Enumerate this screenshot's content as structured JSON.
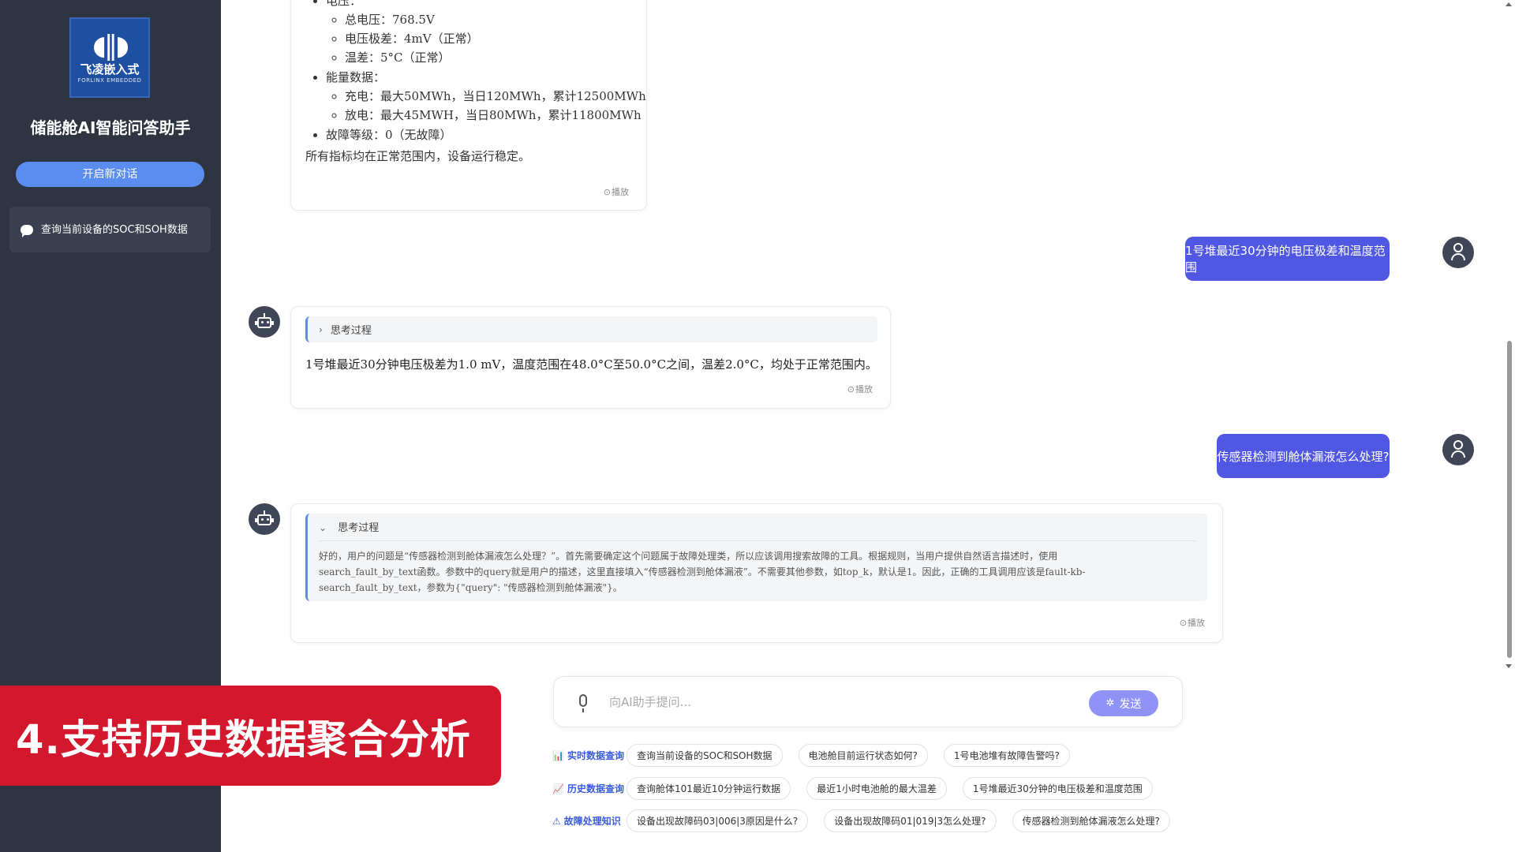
{
  "sidebar": {
    "logo": {
      "brand": "飞凌嵌入式",
      "sub": "FORLINX EMBEDDED"
    },
    "app_title": "储能舱AI智能问答助手",
    "new_chat_label": "开启新对话",
    "history": [
      {
        "label": "查询当前设备的SOC和SOH数据"
      }
    ]
  },
  "conversation": {
    "msg1": {
      "partial_heading": "电压：",
      "voltage_items": [
        "总电压：768.5V",
        "电压极差：4mV（正常）",
        "温差：5°C（正常）"
      ],
      "energy_heading": "能量数据：",
      "energy_items": [
        "充电：最大50MWh，当日120MWh，累计12500MWh",
        "放电：最大45MWH，当日80MWh，累计11800MWh"
      ],
      "fault_level": "故障等级：0（无故障）",
      "conclusion": "所有指标均在正常范围内，设备运行稳定。",
      "play_label": "播放"
    },
    "user1": "1号堆最近30分钟的电压极差和温度范围",
    "msg2": {
      "think_label": "思考过程",
      "answer": "1号堆最近30分钟电压极差为1.0 mV，温度范围在48.0°C至50.0°C之间，温差2.0°C，均处于正常范围内。",
      "play_label": "播放"
    },
    "user2": "传感器检测到舱体漏液怎么处理?",
    "msg3": {
      "think_label": "思考过程",
      "think_body": "好的，用户的问题是“传感器检测到舱体漏液怎么处理？”。首先需要确定这个问题属于故障处理类，所以应该调用搜索故障的工具。根据规则，当用户提供自然语言描述时，使用search_fault_by_text函数。参数中的query就是用户的描述，这里直接填入“传感器检测到舱体漏液”。不需要其他参数，如top_k，默认是1。因此，正确的工具调用应该是fault-kb-search_fault_by_text，参数为{\"query\": \"传感器检测到舱体漏液\"}。",
      "play_label": "播放"
    }
  },
  "input": {
    "placeholder": "向AI助手提问...",
    "send_label": "发送"
  },
  "quick": [
    {
      "label": "实时数据查询",
      "icon": "bar-chart-icon",
      "chips": [
        "查询当前设备的SOC和SOH数据",
        "电池舱目前运行状态如何?",
        "1号电池堆有故障告警吗?"
      ]
    },
    {
      "label": "历史数据查询",
      "icon": "line-chart-icon",
      "chips": [
        "查询舱体101最近10分钟运行数据",
        "最近1小时电池舱的最大温差",
        "1号堆最近30分钟的电压极差和温度范围"
      ]
    },
    {
      "label": "故障处理知识",
      "icon": "warning-icon",
      "chips": [
        "设备出现故障码03|006|3原因是什么?",
        "设备出现故障码01|019|3怎么处理?",
        "传感器检测到舱体漏液怎么处理?"
      ]
    }
  ],
  "caption": "4.支持历史数据聚合分析",
  "colors": {
    "sidebar_bg": "#2f3441",
    "user_bubble": "#4f57e3",
    "new_chat_button": "#5b8cf0",
    "send_button": "#8e93f5",
    "caption_bg": "#d3182e"
  }
}
